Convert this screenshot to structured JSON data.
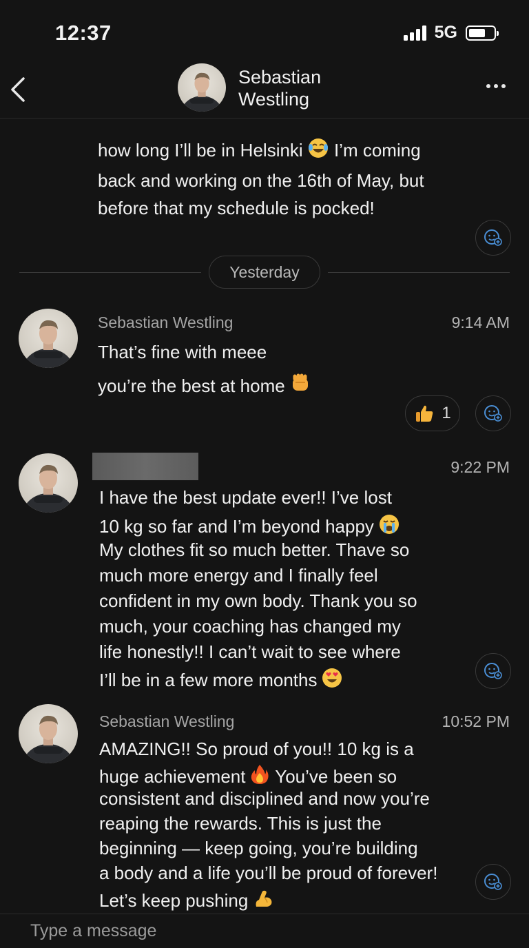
{
  "status_bar": {
    "time": "12:37",
    "network": "5G",
    "battery_level": 0.58
  },
  "header": {
    "contact_name_line1": "Sebastian",
    "contact_name_line2": "Westling"
  },
  "previous_message": {
    "lines": [
      "how long I’ll be in Helsinki",
      "I’m coming",
      "back and working on the 16th of May, but",
      "before that my schedule is pocked!"
    ]
  },
  "date_divider": "Yesterday",
  "messages": [
    {
      "sender": "Sebastian Westling",
      "time": "9:14 AM",
      "lines": [
        "That’s fine with meee",
        "you’re the best at home"
      ],
      "reaction": {
        "icon": "thumbs-up",
        "count": "1"
      }
    },
    {
      "sender": "",
      "time": "9:22 PM",
      "lines": [
        "I have the best update ever!! I’ve lost",
        "10 kg so far and I’m beyond happy",
        "My clothes fit so much better. Thave so",
        "much more energy and I  finally feel",
        "confident in my own body. Thank you so",
        "much, your coaching has changed my",
        "life honestly!! I can’t wait to see where",
        "I’ll be in a few more months"
      ]
    },
    {
      "sender": "Sebastian Westling",
      "time": "10:52 PM",
      "lines": [
        "AMAZING!! So proud of you!! 10 kg is a",
        "huge achievement",
        "You’ve been so",
        "consistent and disciplined and now you’re",
        "reaping the rewards. This is just the",
        "beginning — keep going, you’re building",
        "a body and a life you’ll be proud of forever!",
        "Let’s keep pushing"
      ]
    }
  ],
  "composer": {
    "placeholder": "Type a message"
  },
  "colors": {
    "background": "#141414",
    "text": "#f0f0f0",
    "muted": "#a4a4a4",
    "accent_blue": "#4a8fd6",
    "border": "#3a3a3a"
  }
}
